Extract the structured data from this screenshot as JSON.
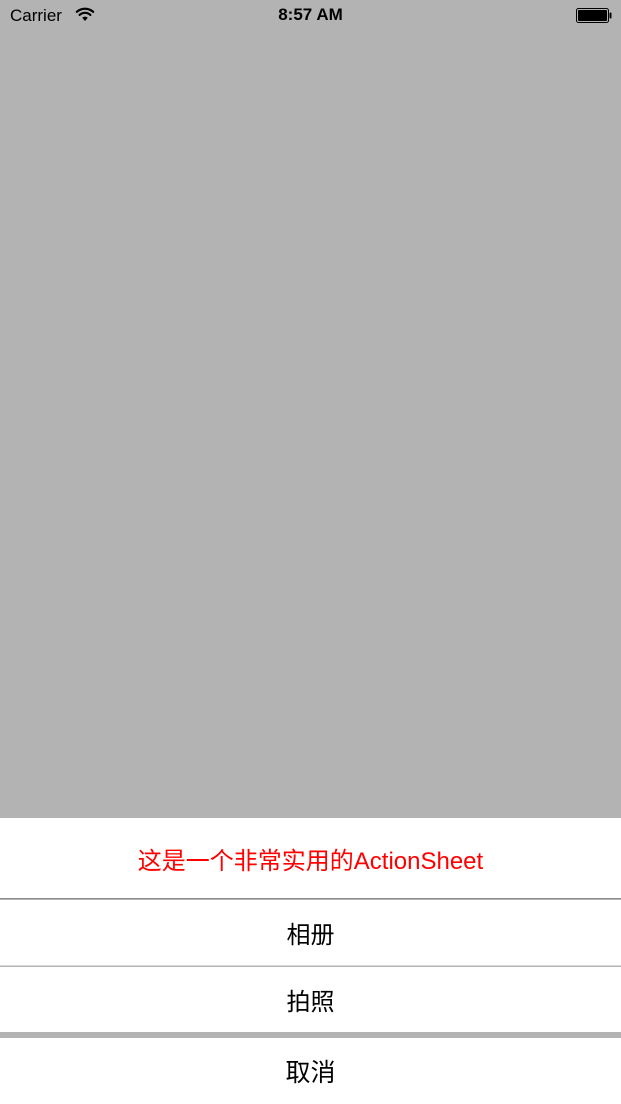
{
  "status_bar": {
    "carrier": "Carrier",
    "time": "8:57 AM",
    "wifi_icon": "wifi-icon",
    "battery_icon": "battery-full-icon"
  },
  "action_sheet": {
    "title": "这是一个非常实用的ActionSheet",
    "title_color": "#ff0000",
    "options": [
      {
        "label": "相册"
      },
      {
        "label": "拍照"
      }
    ],
    "cancel_label": "取消"
  },
  "colors": {
    "dim_background": "#b3b3b3",
    "sheet_background": "#ffffff",
    "text": "#000000"
  }
}
